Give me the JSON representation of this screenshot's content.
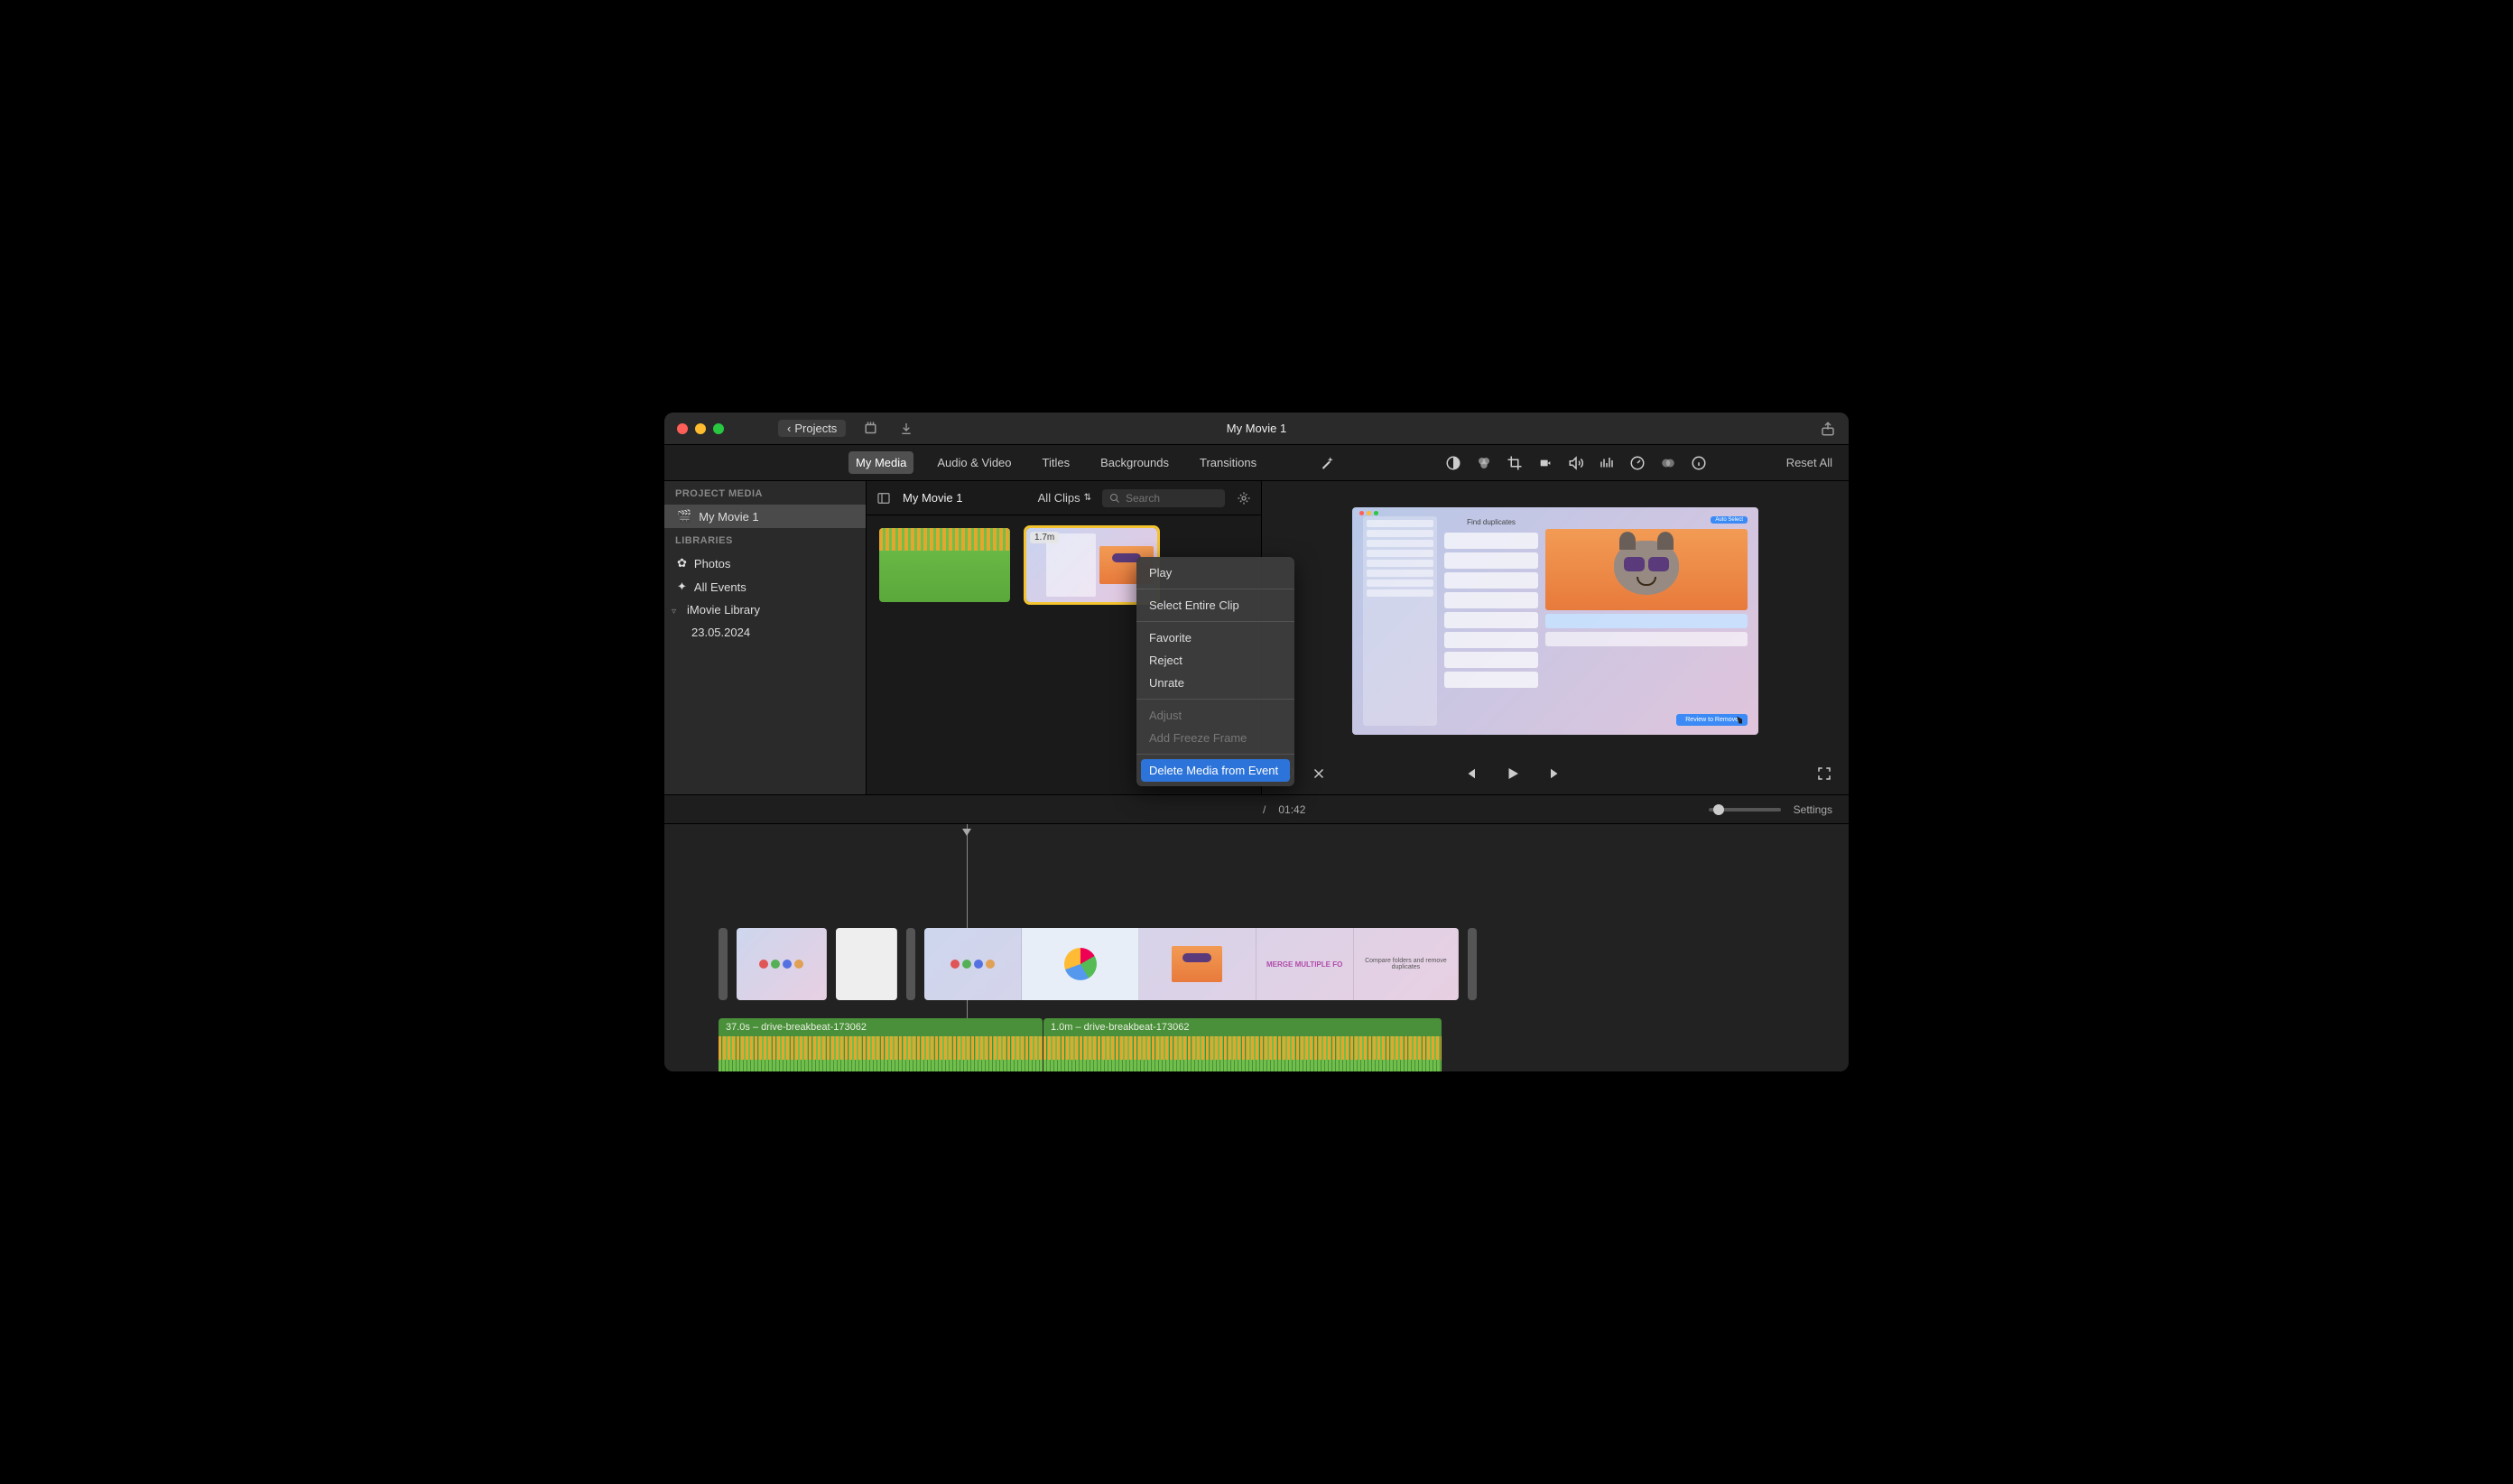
{
  "window": {
    "title": "My Movie 1"
  },
  "titlebar": {
    "back": "Projects"
  },
  "tabs": [
    "My Media",
    "Audio & Video",
    "Titles",
    "Backgrounds",
    "Transitions"
  ],
  "active_tab": 0,
  "reset_all": "Reset All",
  "sidebar": {
    "project_media_hdr": "PROJECT MEDIA",
    "project": "My Movie 1",
    "libraries_hdr": "LIBRARIES",
    "photos": "Photos",
    "all_events": "All Events",
    "imovie_library": "iMovie Library",
    "library_date": "23.05.2024"
  },
  "browser": {
    "title": "My Movie 1",
    "filter": "All Clips",
    "search_placeholder": "Search",
    "clip2_badge": "1.7m"
  },
  "context_menu": {
    "play": "Play",
    "select_entire": "Select Entire Clip",
    "favorite": "Favorite",
    "reject": "Reject",
    "unrate": "Unrate",
    "adjust": "Adjust",
    "freeze": "Add Freeze Frame",
    "delete": "Delete Media from Event"
  },
  "preview": {
    "title": "Find duplicates",
    "button": "Review to Remove",
    "autosel": "Auto Select"
  },
  "timecode": {
    "sep": "/",
    "total": "01:42"
  },
  "settings_label": "Settings",
  "timeline": {
    "audio1": "37.0s – drive-breakbeat-173062",
    "audio2": "1.0m – drive-breakbeat-173062",
    "merge_text": "MERGE MULTIPLE FO",
    "compare_text": "Compare folders and remove duplicates"
  }
}
